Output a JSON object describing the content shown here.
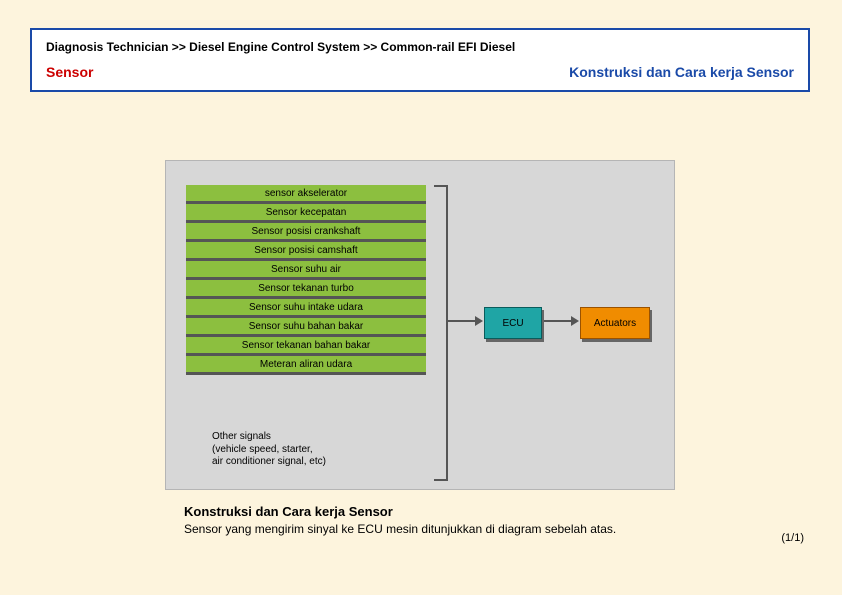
{
  "header": {
    "breadcrumb": "Diagnosis Technician >> Diesel Engine Control System >> Common-rail EFI Diesel",
    "left_title": "Sensor",
    "right_title": "Konstruksi dan Cara kerja Sensor"
  },
  "diagram": {
    "sensors": [
      "sensor akselerator",
      "Sensor kecepatan",
      "Sensor posisi crankshaft",
      "Sensor posisi camshaft",
      "Sensor suhu air",
      "Sensor tekanan turbo",
      "Sensor suhu intake udara",
      "Sensor suhu bahan bakar",
      "Sensor tekanan bahan bakar",
      "Meteran aliran udara"
    ],
    "ecu_label": "ECU",
    "actuators_label": "Actuators",
    "other_signals_line1": "Other signals",
    "other_signals_line2": "(vehicle speed, starter,",
    "other_signals_line3": "air conditioner signal, etc)"
  },
  "body": {
    "heading": "Konstruksi dan Cara kerja Sensor",
    "text": "Sensor yang mengirim sinyal ke ECU mesin ditunjukkan di diagram sebelah atas."
  },
  "page_counter": "(1/1)",
  "chart_data": {
    "type": "diagram",
    "title": "Konstruksi dan Cara kerja Sensor",
    "nodes": [
      {
        "id": "sensors_group",
        "label": "Sensors",
        "items": [
          "sensor akselerator",
          "Sensor kecepatan",
          "Sensor posisi crankshaft",
          "Sensor posisi camshaft",
          "Sensor suhu air",
          "Sensor tekanan turbo",
          "Sensor suhu intake udara",
          "Sensor suhu bahan bakar",
          "Sensor tekanan bahan bakar",
          "Meteran aliran udara"
        ]
      },
      {
        "id": "other_signals",
        "label": "Other signals (vehicle speed, starter, air conditioner signal, etc)"
      },
      {
        "id": "ecu",
        "label": "ECU"
      },
      {
        "id": "actuators",
        "label": "Actuators"
      }
    ],
    "edges": [
      {
        "from": "sensors_group",
        "to": "ecu"
      },
      {
        "from": "other_signals",
        "to": "ecu"
      },
      {
        "from": "ecu",
        "to": "actuators"
      }
    ]
  }
}
